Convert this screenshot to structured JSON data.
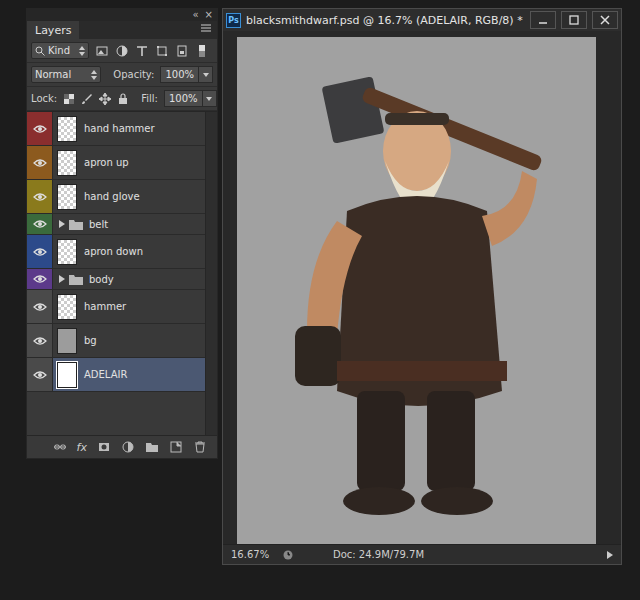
{
  "layers_panel": {
    "collapse_glyph": "«",
    "close_glyph": "×",
    "tab": {
      "label": "Layers",
      "selected": true
    },
    "filter": {
      "value": "Kind"
    },
    "blend_mode": "Normal",
    "opacity_label": "Opacity:",
    "opacity": "100%",
    "lock_label": "Lock:",
    "fill_label": "Fill:",
    "fill": "100%",
    "layers": [
      {
        "name": "hand hammer",
        "kind": "layer",
        "visible": true,
        "selected": false,
        "color": "#8a2e2e",
        "thumb": "transparent"
      },
      {
        "name": "apron up",
        "kind": "layer",
        "visible": true,
        "selected": false,
        "color": "#8c5a1e",
        "thumb": "transparent"
      },
      {
        "name": "hand glove",
        "kind": "layer",
        "visible": true,
        "selected": false,
        "color": "#8a7a1c",
        "thumb": "transparent"
      },
      {
        "name": "belt",
        "kind": "group",
        "visible": true,
        "selected": false,
        "expanded": false,
        "color": "#3a6a3c",
        "thumb": "none"
      },
      {
        "name": "apron down",
        "kind": "layer",
        "visible": true,
        "selected": false,
        "color": "#2c4a8a",
        "thumb": "transparent"
      },
      {
        "name": "body",
        "kind": "group",
        "visible": true,
        "selected": false,
        "expanded": false,
        "color": "#5c3a8a",
        "thumb": "none"
      },
      {
        "name": "hammer",
        "kind": "layer",
        "visible": true,
        "selected": false,
        "color": "#4a4a4a",
        "thumb": "transparent"
      },
      {
        "name": "bg",
        "kind": "layer",
        "visible": true,
        "selected": false,
        "color": "#4a4a4a",
        "thumb": "#9c9c9c"
      },
      {
        "name": "ADELAIR",
        "kind": "layer",
        "visible": true,
        "selected": true,
        "color": "#4a4a4a",
        "thumb": "#ffffff"
      }
    ],
    "fx_label": "fx"
  },
  "document": {
    "app_badge": "Ps",
    "title": "blacksmithdwarf.psd @ 16.7% (ADELAIR, RGB/8) *",
    "status": {
      "zoom": "16.67%",
      "doc_size": "Doc: 24.9M/79.7M"
    }
  }
}
